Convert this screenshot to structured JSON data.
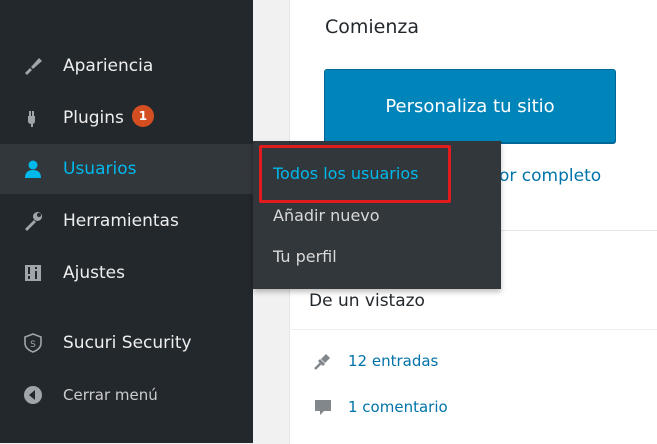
{
  "sidebar": {
    "items": [
      {
        "label": "Apariencia",
        "icon": "paintbrush-icon"
      },
      {
        "label": "Plugins",
        "icon": "plugin-icon",
        "badge": "1"
      },
      {
        "label": "Usuarios",
        "icon": "users-icon",
        "current": true
      },
      {
        "label": "Herramientas",
        "icon": "wrench-icon"
      },
      {
        "label": "Ajustes",
        "icon": "settings-icon"
      },
      {
        "label": "Sucuri Security",
        "icon": "shield-icon"
      }
    ],
    "collapse_label": "Cerrar menú"
  },
  "submenu": {
    "items": [
      {
        "label": "Todos los usuarios",
        "current": true
      },
      {
        "label": "Añadir nuevo"
      },
      {
        "label": "Tu perfil"
      }
    ]
  },
  "welcome": {
    "heading": "Comienza",
    "button_label": "Personaliza tu sitio",
    "partial_link": "or completo"
  },
  "glance": {
    "title": "De un vistazo",
    "posts": "12 entradas",
    "comments": "1 comentario"
  },
  "colors": {
    "sidebar_bg": "#23282d",
    "submenu_bg": "#32373c",
    "accent": "#00b9eb",
    "button": "#0085ba",
    "link": "#0073aa",
    "badge": "#d54e21",
    "highlight": "#e21c1c"
  }
}
